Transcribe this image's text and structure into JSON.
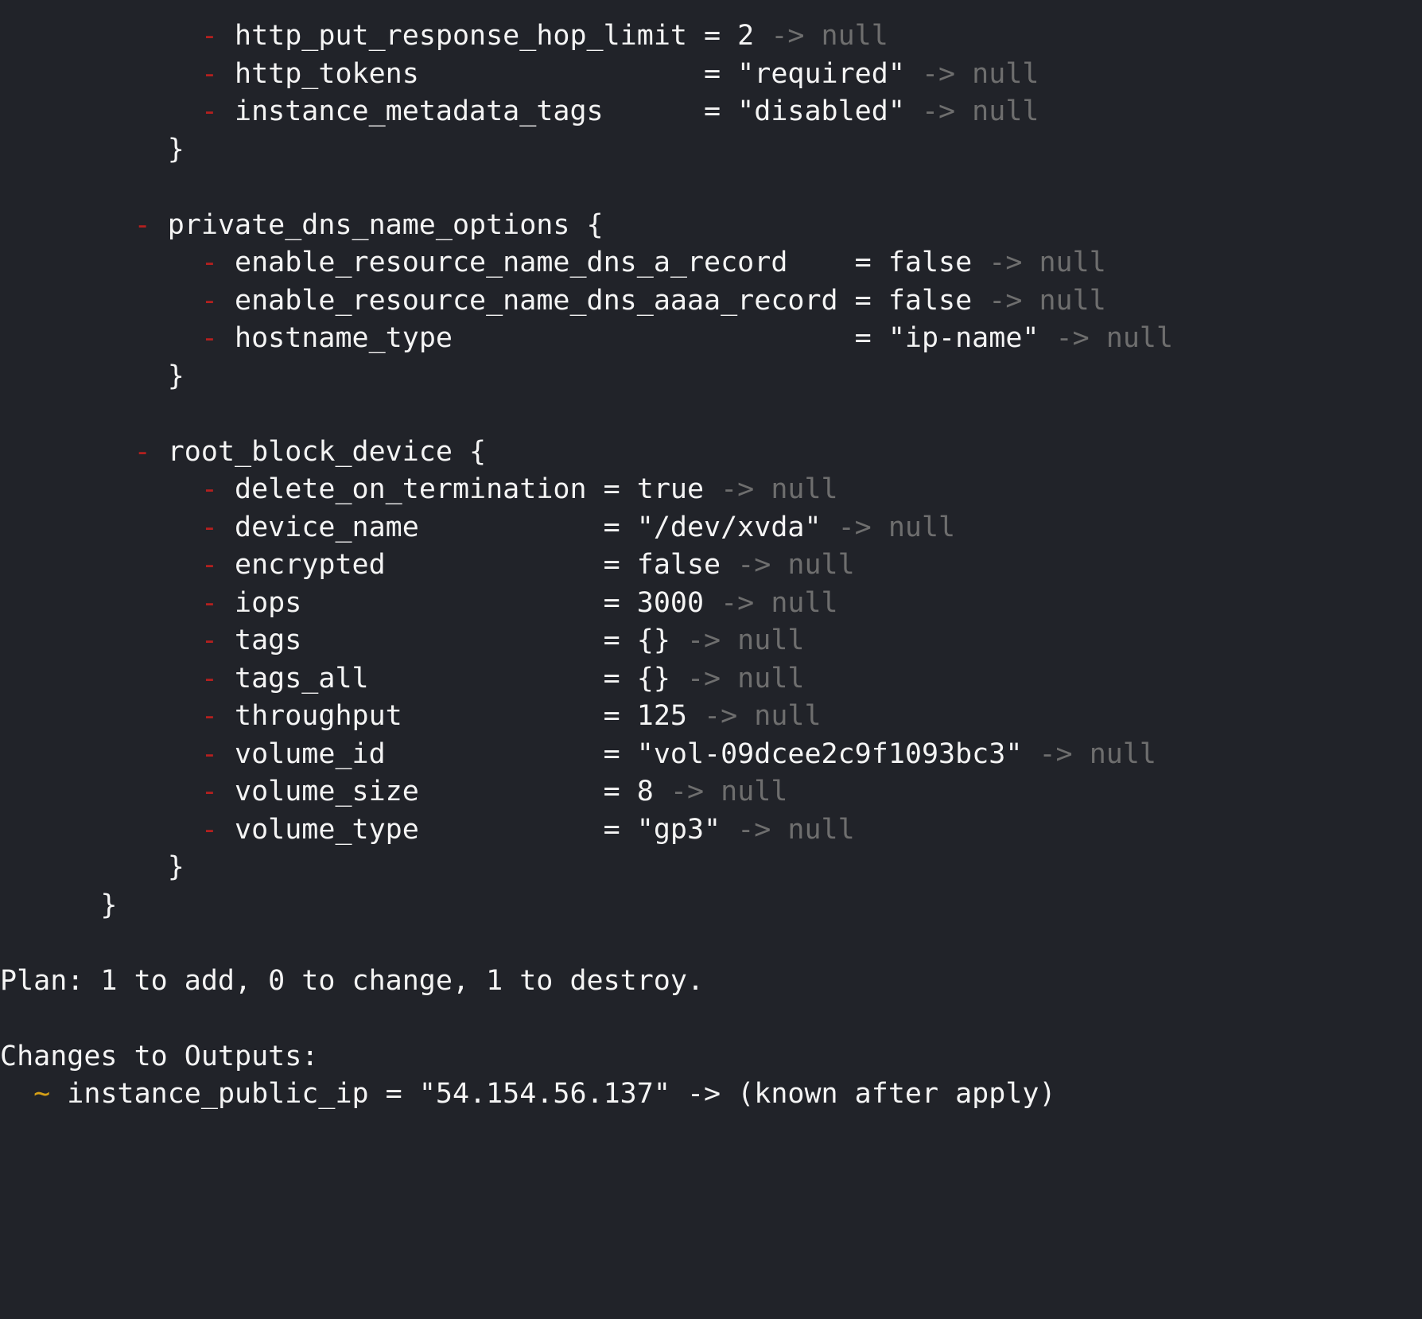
{
  "terminal": {
    "title": "terraform-plan-output",
    "background_color": "#212329",
    "foreground_color": "#f4f4f4",
    "colors": {
      "destroy_marker": "#b3201f",
      "null_value": "#6e6e6e",
      "update_marker": "#d6a017",
      "plain_text": "#f4f4f4"
    }
  },
  "lines": [
    {
      "id": "l1",
      "segments": [
        {
          "text": "            ",
          "color": "plain"
        },
        {
          "text": "-",
          "color": "red"
        },
        {
          "text": " http_put_response_hop_limit = 2 ",
          "color": "plain"
        },
        {
          "text": "-> null",
          "color": "gray"
        }
      ]
    },
    {
      "id": "l2",
      "segments": [
        {
          "text": "            ",
          "color": "plain"
        },
        {
          "text": "-",
          "color": "red"
        },
        {
          "text": " http_tokens                 = \"required\" ",
          "color": "plain"
        },
        {
          "text": "-> null",
          "color": "gray"
        }
      ]
    },
    {
      "id": "l3",
      "segments": [
        {
          "text": "            ",
          "color": "plain"
        },
        {
          "text": "-",
          "color": "red"
        },
        {
          "text": " instance_metadata_tags      = \"disabled\" ",
          "color": "plain"
        },
        {
          "text": "-> null",
          "color": "gray"
        }
      ]
    },
    {
      "id": "l4",
      "segments": [
        {
          "text": "          }",
          "color": "plain"
        }
      ]
    },
    {
      "id": "l5",
      "segments": []
    },
    {
      "id": "l6",
      "segments": [
        {
          "text": "        ",
          "color": "plain"
        },
        {
          "text": "-",
          "color": "red"
        },
        {
          "text": " private_dns_name_options {",
          "color": "plain"
        }
      ]
    },
    {
      "id": "l7",
      "segments": [
        {
          "text": "            ",
          "color": "plain"
        },
        {
          "text": "-",
          "color": "red"
        },
        {
          "text": " enable_resource_name_dns_a_record    = false ",
          "color": "plain"
        },
        {
          "text": "-> null",
          "color": "gray"
        }
      ]
    },
    {
      "id": "l8",
      "segments": [
        {
          "text": "            ",
          "color": "plain"
        },
        {
          "text": "-",
          "color": "red"
        },
        {
          "text": " enable_resource_name_dns_aaaa_record = false ",
          "color": "plain"
        },
        {
          "text": "-> null",
          "color": "gray"
        }
      ]
    },
    {
      "id": "l9",
      "segments": [
        {
          "text": "            ",
          "color": "plain"
        },
        {
          "text": "-",
          "color": "red"
        },
        {
          "text": " hostname_type                        = \"ip-name\" ",
          "color": "plain"
        },
        {
          "text": "-> null",
          "color": "gray"
        }
      ]
    },
    {
      "id": "l10",
      "segments": [
        {
          "text": "          }",
          "color": "plain"
        }
      ]
    },
    {
      "id": "l11",
      "segments": []
    },
    {
      "id": "l12",
      "segments": [
        {
          "text": "        ",
          "color": "plain"
        },
        {
          "text": "-",
          "color": "red"
        },
        {
          "text": " root_block_device {",
          "color": "plain"
        }
      ]
    },
    {
      "id": "l13",
      "segments": [
        {
          "text": "            ",
          "color": "plain"
        },
        {
          "text": "-",
          "color": "red"
        },
        {
          "text": " delete_on_termination = true ",
          "color": "plain"
        },
        {
          "text": "-> null",
          "color": "gray"
        }
      ]
    },
    {
      "id": "l14",
      "segments": [
        {
          "text": "            ",
          "color": "plain"
        },
        {
          "text": "-",
          "color": "red"
        },
        {
          "text": " device_name           = \"/dev/xvda\" ",
          "color": "plain"
        },
        {
          "text": "-> null",
          "color": "gray"
        }
      ]
    },
    {
      "id": "l15",
      "segments": [
        {
          "text": "            ",
          "color": "plain"
        },
        {
          "text": "-",
          "color": "red"
        },
        {
          "text": " encrypted             = false ",
          "color": "plain"
        },
        {
          "text": "-> null",
          "color": "gray"
        }
      ]
    },
    {
      "id": "l16",
      "segments": [
        {
          "text": "            ",
          "color": "plain"
        },
        {
          "text": "-",
          "color": "red"
        },
        {
          "text": " iops                  = 3000 ",
          "color": "plain"
        },
        {
          "text": "-> null",
          "color": "gray"
        }
      ]
    },
    {
      "id": "l17",
      "segments": [
        {
          "text": "            ",
          "color": "plain"
        },
        {
          "text": "-",
          "color": "red"
        },
        {
          "text": " tags                  = {} ",
          "color": "plain"
        },
        {
          "text": "-> null",
          "color": "gray"
        }
      ]
    },
    {
      "id": "l18",
      "segments": [
        {
          "text": "            ",
          "color": "plain"
        },
        {
          "text": "-",
          "color": "red"
        },
        {
          "text": " tags_all              = {} ",
          "color": "plain"
        },
        {
          "text": "-> null",
          "color": "gray"
        }
      ]
    },
    {
      "id": "l19",
      "segments": [
        {
          "text": "            ",
          "color": "plain"
        },
        {
          "text": "-",
          "color": "red"
        },
        {
          "text": " throughput            = 125 ",
          "color": "plain"
        },
        {
          "text": "-> null",
          "color": "gray"
        }
      ]
    },
    {
      "id": "l20",
      "segments": [
        {
          "text": "            ",
          "color": "plain"
        },
        {
          "text": "-",
          "color": "red"
        },
        {
          "text": " volume_id             = \"vol-09dcee2c9f1093bc3\" ",
          "color": "plain"
        },
        {
          "text": "-> null",
          "color": "gray"
        }
      ]
    },
    {
      "id": "l21",
      "segments": [
        {
          "text": "            ",
          "color": "plain"
        },
        {
          "text": "-",
          "color": "red"
        },
        {
          "text": " volume_size           = 8 ",
          "color": "plain"
        },
        {
          "text": "-> null",
          "color": "gray"
        }
      ]
    },
    {
      "id": "l22",
      "segments": [
        {
          "text": "            ",
          "color": "plain"
        },
        {
          "text": "-",
          "color": "red"
        },
        {
          "text": " volume_type           = \"gp3\" ",
          "color": "plain"
        },
        {
          "text": "-> null",
          "color": "gray"
        }
      ]
    },
    {
      "id": "l23",
      "segments": [
        {
          "text": "          }",
          "color": "plain"
        }
      ]
    },
    {
      "id": "l24",
      "segments": [
        {
          "text": "      }",
          "color": "plain"
        }
      ]
    },
    {
      "id": "l25",
      "segments": []
    },
    {
      "id": "l26",
      "segments": [
        {
          "text": "Plan: 1 to add, 0 to change, 1 to destroy.",
          "color": "plain"
        }
      ]
    },
    {
      "id": "l27",
      "segments": []
    },
    {
      "id": "l28",
      "segments": [
        {
          "text": "Changes to Outputs:",
          "color": "plain"
        }
      ]
    },
    {
      "id": "l29",
      "segments": [
        {
          "text": "  ",
          "color": "plain"
        },
        {
          "text": "~",
          "color": "yellow"
        },
        {
          "text": " instance_public_ip = \"54.154.56.137\" -> (known after apply)",
          "color": "plain"
        }
      ]
    }
  ],
  "summary": {
    "plan_line": "Plan: 1 to add, 0 to change, 1 to destroy.",
    "add_count": "1",
    "change_count": "0",
    "destroy_count": "1",
    "outputs_header": "Changes to Outputs:",
    "output_name": "instance_public_ip",
    "output_old_value": "\"54.154.56.137\"",
    "output_new_value": "(known after apply)"
  }
}
